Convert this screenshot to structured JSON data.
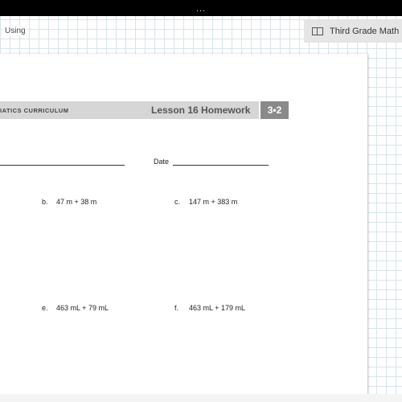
{
  "app": {
    "topbar_dots": "...",
    "left_label": "Using",
    "tab_label": "Third Grade Math"
  },
  "worksheet": {
    "curriculum": "IATICS CURRICULUM",
    "lesson": "Lesson 16 Homework",
    "badge": "3•2",
    "date_label": "Date",
    "problems": [
      {
        "letter": "b.",
        "expr": "47 m  +  38 m"
      },
      {
        "letter": "c.",
        "expr": "147 m  +  383 m"
      },
      {
        "letter": "e.",
        "expr": "463 mL  +  79 mL"
      },
      {
        "letter": "f.",
        "expr": "463 mL  +  179 mL"
      }
    ]
  },
  "colors": {
    "grid": "#d8e4e8",
    "banner": "#d6d6d6",
    "badge": "#8a8a8a"
  }
}
